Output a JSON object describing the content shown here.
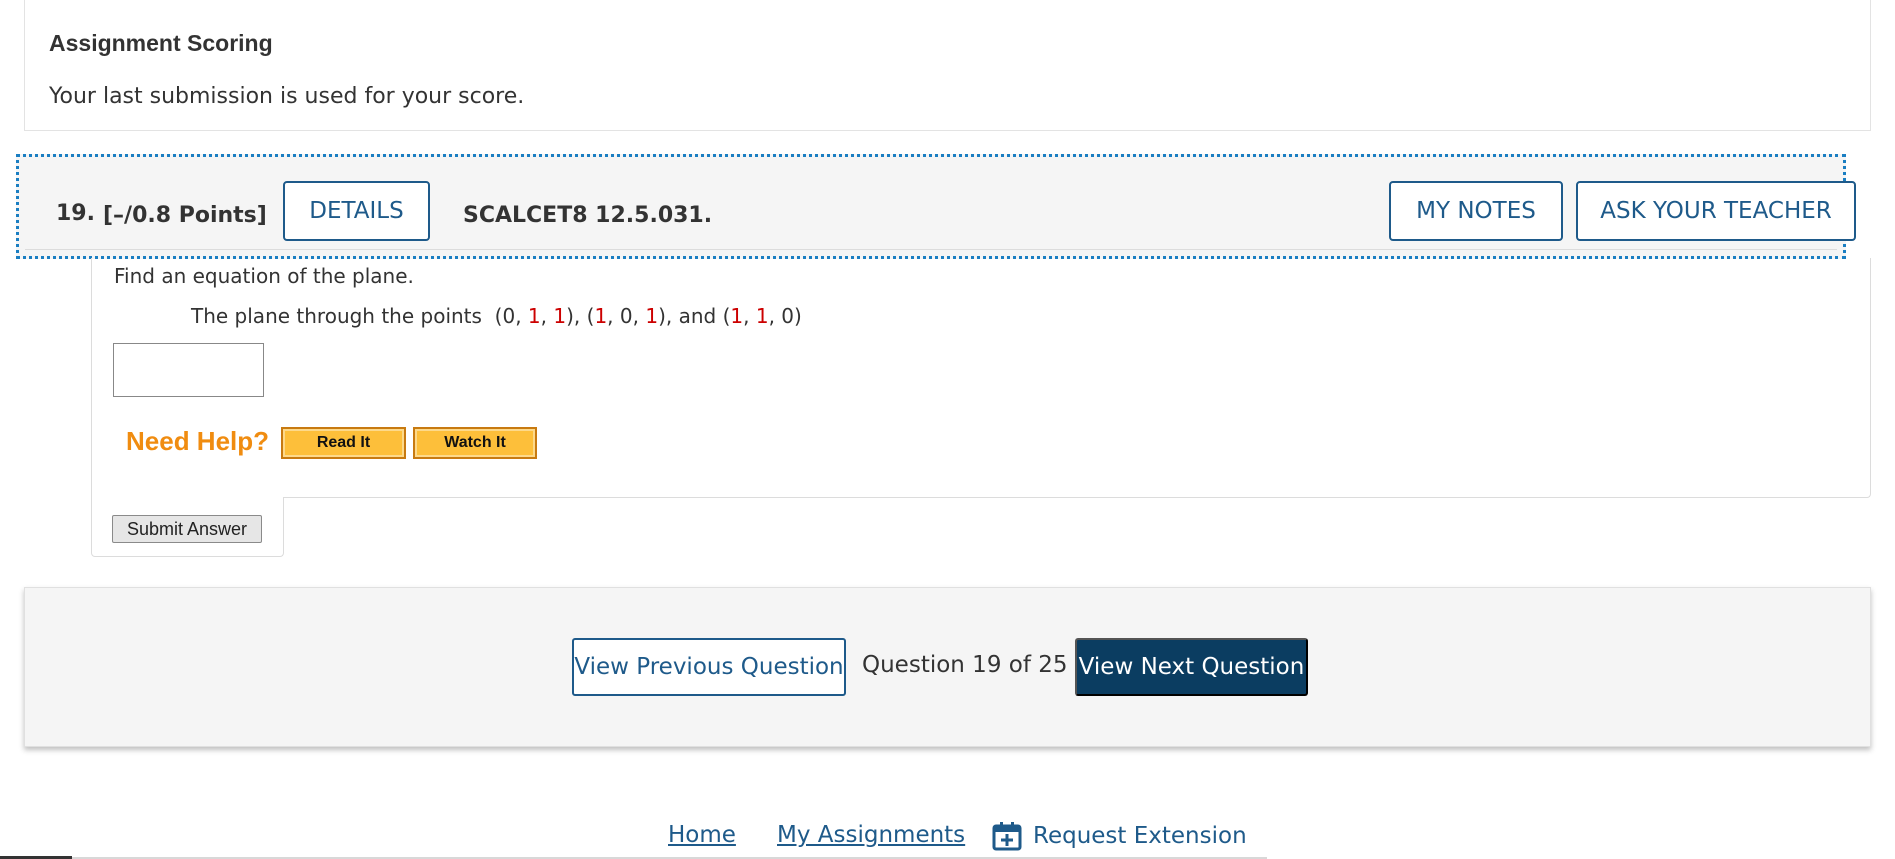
{
  "assignment_scoring": {
    "title": "Assignment Scoring",
    "text": "Your last submission is used for your score."
  },
  "question": {
    "number": "19.",
    "points": "[–/0.8 Points]",
    "details_label": "DETAILS",
    "code": "SCALCET8 12.5.031.",
    "my_notes_label": "MY NOTES",
    "ask_teacher_label": "ASK YOUR TEACHER",
    "prompt": "Find an equation of the plane.",
    "detail_prefix": "The plane through the points  ",
    "points_text": [
      {
        "text": "(0, ",
        "red": false
      },
      {
        "text": "1",
        "red": true
      },
      {
        "text": ", ",
        "red": false
      },
      {
        "text": "1",
        "red": true
      },
      {
        "text": "), (",
        "red": false
      },
      {
        "text": "1",
        "red": true
      },
      {
        "text": ", 0, ",
        "red": false
      },
      {
        "text": "1",
        "red": true
      },
      {
        "text": "), and (",
        "red": false
      },
      {
        "text": "1",
        "red": true
      },
      {
        "text": ", ",
        "red": false
      },
      {
        "text": "1",
        "red": true
      },
      {
        "text": ", 0)",
        "red": false
      }
    ],
    "answer_value": "",
    "need_help_label": "Need Help?",
    "read_it_label": "Read It",
    "watch_it_label": "Watch It",
    "submit_label": "Submit Answer"
  },
  "navigation": {
    "previous_label": "View Previous Question",
    "counter": "Question 19 of 25",
    "next_label": "View Next Question"
  },
  "footer": {
    "home": "Home",
    "my_assignments": "My Assignments",
    "request_extension": "Request Extension",
    "extension_icon": "calendar-plus-icon"
  },
  "colors": {
    "link_blue": "#1e5a8a",
    "next_button_bg": "#0b3d61",
    "help_orange": "#f08c10",
    "highlight_red": "#cc0000",
    "focus_dotted_border": "#1a7ec2"
  }
}
